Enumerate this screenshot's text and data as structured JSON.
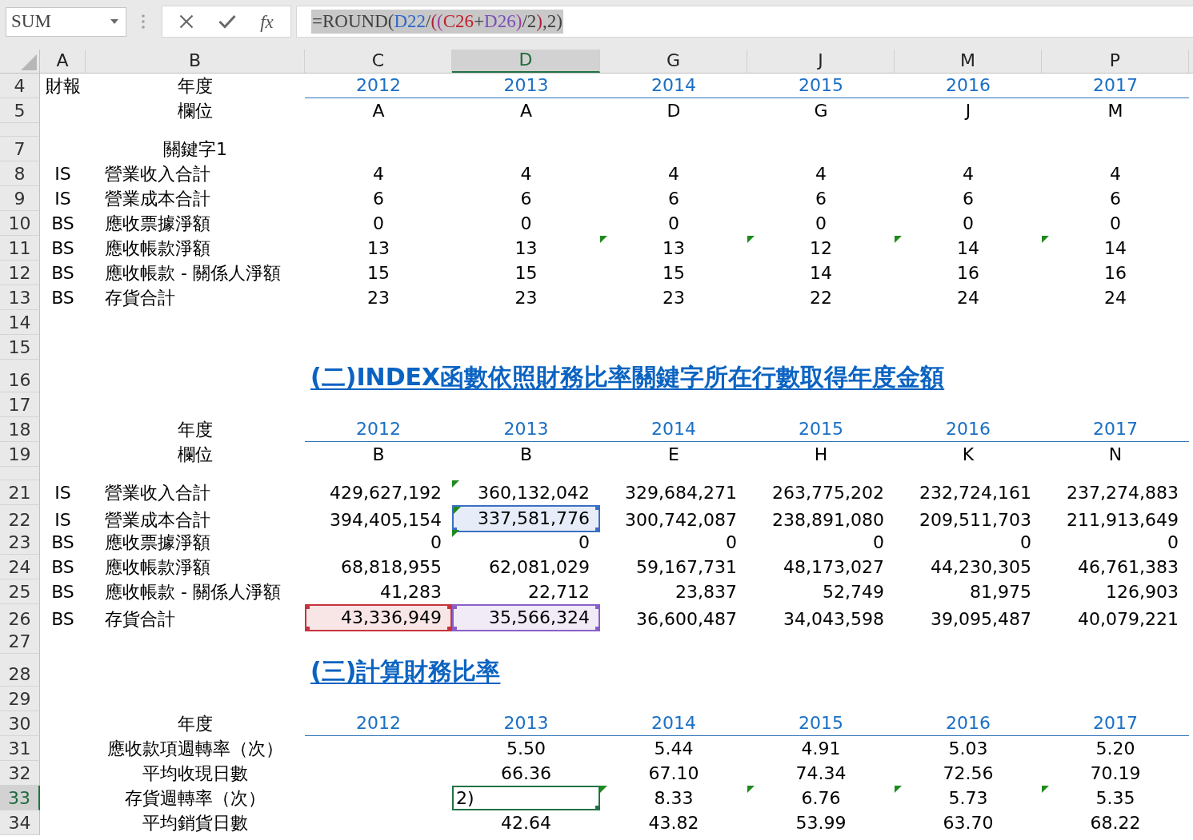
{
  "formula_bar": {
    "name_box": "SUM",
    "function_label": "fx",
    "formula": {
      "selected": true,
      "segments": [
        {
          "text": "=ROUND(",
          "color": "#404040"
        },
        {
          "text": "D22",
          "color": "#2f68c8"
        },
        {
          "text": "/",
          "color": "#404040"
        },
        {
          "text": "(",
          "color": "#b0203c"
        },
        {
          "text": "(",
          "color": "#9a3fa0"
        },
        {
          "text": "C26",
          "color": "#c0202a"
        },
        {
          "text": "+",
          "color": "#404040"
        },
        {
          "text": "D26",
          "color": "#7a4fb8"
        },
        {
          "text": ")",
          "color": "#9a3fa0"
        },
        {
          "text": "/2",
          "color": "#404040"
        },
        {
          "text": ")",
          "color": "#b0203c"
        },
        {
          "text": ",2)",
          "color": "#404040"
        }
      ]
    }
  },
  "sheet": {
    "columns": [
      {
        "label": "A",
        "selected": false
      },
      {
        "label": "B",
        "selected": false
      },
      {
        "label": "C",
        "selected": false
      },
      {
        "label": "D",
        "selected": true
      },
      {
        "label": "G",
        "selected": false
      },
      {
        "label": "J",
        "selected": false
      },
      {
        "label": "M",
        "selected": false
      },
      {
        "label": "P",
        "selected": false
      }
    ],
    "rows": [
      {
        "number": "4",
        "selected": false,
        "kind": "years",
        "a": "財報",
        "b": "年度",
        "cells": [
          "2012",
          "2013",
          "2014",
          "2015",
          "2016",
          "2017"
        ]
      },
      {
        "number": "5",
        "selected": false,
        "kind": "letters",
        "b": "欄位",
        "cells": [
          "A",
          "A",
          "D",
          "G",
          "J",
          "M"
        ]
      },
      {
        "selected": false,
        "kind": "short"
      },
      {
        "number": "7",
        "selected": false,
        "kind": "keyword",
        "b": "關鍵字1"
      },
      {
        "number": "8",
        "selected": false,
        "kind": "lookup",
        "a": "IS",
        "b": "營業收入合計",
        "cells": [
          {
            "text": "4",
            "flag": false,
            "selected": false
          },
          {
            "text": "4",
            "flag": false,
            "selected": false
          },
          {
            "text": "4",
            "flag": false,
            "selected": false
          },
          {
            "text": "4",
            "flag": false,
            "selected": false
          },
          {
            "text": "4",
            "flag": false,
            "selected": false
          },
          {
            "text": "4",
            "flag": false,
            "selected": false
          }
        ]
      },
      {
        "number": "9",
        "selected": false,
        "kind": "lookup",
        "a": "IS",
        "b": "營業成本合計",
        "cells": [
          {
            "text": "6",
            "flag": false,
            "selected": false
          },
          {
            "text": "6",
            "flag": false,
            "selected": false
          },
          {
            "text": "6",
            "flag": false,
            "selected": false
          },
          {
            "text": "6",
            "flag": false,
            "selected": false
          },
          {
            "text": "6",
            "flag": false,
            "selected": false
          },
          {
            "text": "6",
            "flag": false,
            "selected": false
          }
        ]
      },
      {
        "number": "10",
        "selected": false,
        "kind": "lookup",
        "a": "BS",
        "b": "應收票據淨額",
        "cells": [
          {
            "text": "0",
            "flag": false,
            "selected": false
          },
          {
            "text": "0",
            "flag": false,
            "selected": false
          },
          {
            "text": "0",
            "flag": false,
            "selected": false
          },
          {
            "text": "0",
            "flag": false,
            "selected": false
          },
          {
            "text": "0",
            "flag": false,
            "selected": false
          },
          {
            "text": "0",
            "flag": false,
            "selected": false
          }
        ]
      },
      {
        "number": "11",
        "selected": false,
        "kind": "lookup",
        "a": "BS",
        "b": "應收帳款淨額",
        "cells": [
          {
            "text": "13",
            "flag": false,
            "selected": false
          },
          {
            "text": "13",
            "flag": false,
            "selected": false
          },
          {
            "text": "13",
            "flag": true,
            "selected": false
          },
          {
            "text": "12",
            "flag": true,
            "selected": false
          },
          {
            "text": "14",
            "flag": true,
            "selected": false
          },
          {
            "text": "14",
            "flag": true,
            "selected": false
          }
        ]
      },
      {
        "number": "12",
        "selected": false,
        "kind": "lookup",
        "a": "BS",
        "b": "應收帳款 - 關係人淨額",
        "cells": [
          {
            "text": "15",
            "flag": false,
            "selected": false
          },
          {
            "text": "15",
            "flag": false,
            "selected": false
          },
          {
            "text": "15",
            "flag": false,
            "selected": false
          },
          {
            "text": "14",
            "flag": false,
            "selected": false
          },
          {
            "text": "16",
            "flag": false,
            "selected": false
          },
          {
            "text": "16",
            "flag": false,
            "selected": false
          }
        ]
      },
      {
        "number": "13",
        "selected": false,
        "kind": "lookup",
        "a": "BS",
        "b": "存貨合計",
        "cells": [
          {
            "text": "23",
            "flag": false,
            "selected": false
          },
          {
            "text": "23",
            "flag": false,
            "selected": false
          },
          {
            "text": "23",
            "flag": false,
            "selected": false
          },
          {
            "text": "22",
            "flag": false,
            "selected": false
          },
          {
            "text": "24",
            "flag": false,
            "selected": false
          },
          {
            "text": "24",
            "flag": false,
            "selected": false
          }
        ]
      },
      {
        "number": "14",
        "selected": false,
        "kind": "blank"
      },
      {
        "number": "15",
        "selected": false,
        "kind": "blank"
      },
      {
        "number": "16",
        "selected": false,
        "kind": "title",
        "title": "(二)INDEX函數依照財務比率關鍵字所在行數取得年度金額"
      },
      {
        "number": "17",
        "selected": false,
        "kind": "blank"
      },
      {
        "number": "18",
        "selected": false,
        "kind": "years",
        "b": "年度",
        "cells": [
          "2012",
          "2013",
          "2014",
          "2015",
          "2016",
          "2017"
        ]
      },
      {
        "number": "19",
        "selected": false,
        "kind": "letters",
        "b": "欄位",
        "cells": [
          "B",
          "B",
          "E",
          "H",
          "K",
          "N"
        ]
      },
      {
        "selected": false,
        "kind": "short"
      },
      {
        "number": "21",
        "selected": false,
        "kind": "amount",
        "a": "IS",
        "b": "營業收入合計",
        "cells": [
          {
            "text": "429,627,192",
            "flag": false,
            "selected": false
          },
          {
            "text": "360,132,042",
            "flag": true,
            "selected": false
          },
          {
            "text": "329,684,271",
            "flag": false,
            "selected": false
          },
          {
            "text": "263,775,202",
            "flag": false,
            "selected": false
          },
          {
            "text": "232,724,161",
            "flag": false,
            "selected": false
          },
          {
            "text": "237,274,883",
            "flag": false,
            "selected": false
          }
        ]
      },
      {
        "number": "22",
        "selected": false,
        "kind": "amount",
        "a": "IS",
        "b": "營業成本合計",
        "cells": [
          {
            "text": "394,405,154",
            "flag": false,
            "selected": false
          },
          {
            "text": "337,581,776",
            "flag": true,
            "selected": false,
            "color": "#3a6fc4"
          },
          {
            "text": "300,742,087",
            "flag": false,
            "selected": false
          },
          {
            "text": "238,891,080",
            "flag": false,
            "selected": false
          },
          {
            "text": "209,511,703",
            "flag": false,
            "selected": false
          },
          {
            "text": "211,913,649",
            "flag": false,
            "selected": false
          }
        ]
      },
      {
        "number": "23",
        "selected": false,
        "kind": "amount",
        "a": "BS",
        "b": "應收票據淨額",
        "cells": [
          {
            "text": "0",
            "flag": false,
            "selected": false
          },
          {
            "text": "0",
            "flag": true,
            "selected": false
          },
          {
            "text": "0",
            "flag": false,
            "selected": false
          },
          {
            "text": "0",
            "flag": false,
            "selected": false
          },
          {
            "text": "0",
            "flag": false,
            "selected": false
          },
          {
            "text": "0",
            "flag": false,
            "selected": false
          }
        ]
      },
      {
        "number": "24",
        "selected": false,
        "kind": "amount",
        "a": "BS",
        "b": "應收帳款淨額",
        "cells": [
          {
            "text": "68,818,955",
            "flag": false,
            "selected": false
          },
          {
            "text": "62,081,029",
            "flag": false,
            "selected": false
          },
          {
            "text": "59,167,731",
            "flag": false,
            "selected": false
          },
          {
            "text": "48,173,027",
            "flag": false,
            "selected": false
          },
          {
            "text": "44,230,305",
            "flag": false,
            "selected": false
          },
          {
            "text": "46,761,383",
            "flag": false,
            "selected": false
          }
        ]
      },
      {
        "number": "25",
        "selected": false,
        "kind": "amount",
        "a": "BS",
        "b": "應收帳款 - 關係人淨額",
        "cells": [
          {
            "text": "41,283",
            "flag": false,
            "selected": false
          },
          {
            "text": "22,712",
            "flag": false,
            "selected": false
          },
          {
            "text": "23,837",
            "flag": false,
            "selected": false
          },
          {
            "text": "52,749",
            "flag": false,
            "selected": false
          },
          {
            "text": "81,975",
            "flag": false,
            "selected": false
          },
          {
            "text": "126,903",
            "flag": false,
            "selected": false
          }
        ]
      },
      {
        "number": "26",
        "selected": false,
        "kind": "amount",
        "a": "BS",
        "b": "存貨合計",
        "cells": [
          {
            "text": "43,336,949",
            "flag": false,
            "selected": false,
            "color": "#c8323c"
          },
          {
            "text": "35,566,324",
            "flag": false,
            "selected": false,
            "color": "#8a5ec8"
          },
          {
            "text": "36,600,487",
            "flag": false,
            "selected": false
          },
          {
            "text": "34,043,598",
            "flag": false,
            "selected": false
          },
          {
            "text": "39,095,487",
            "flag": false,
            "selected": false
          },
          {
            "text": "40,079,221",
            "flag": false,
            "selected": false
          }
        ]
      },
      {
        "number": "27",
        "selected": false,
        "kind": "blank"
      },
      {
        "number": "28",
        "selected": false,
        "kind": "title",
        "title": "(三)計算財務比率"
      },
      {
        "number": "29",
        "selected": false,
        "kind": "blank"
      },
      {
        "number": "30",
        "selected": false,
        "kind": "years",
        "b": "年度",
        "cells": [
          "2012",
          "2013",
          "2014",
          "2015",
          "2016",
          "2017"
        ]
      },
      {
        "number": "31",
        "selected": false,
        "kind": "ratio",
        "b": "應收款項週轉率（次）",
        "cells": [
          {
            "flag": false,
            "selected": false
          },
          {
            "text": "5.50",
            "flag": false,
            "selected": false
          },
          {
            "text": "5.44",
            "flag": false,
            "selected": false
          },
          {
            "text": "4.91",
            "flag": false,
            "selected": false
          },
          {
            "text": "5.03",
            "flag": false,
            "selected": false
          },
          {
            "text": "5.20",
            "flag": false,
            "selected": false
          }
        ]
      },
      {
        "number": "32",
        "selected": false,
        "kind": "ratio",
        "b": "平均收現日數",
        "cells": [
          {
            "flag": false,
            "selected": false
          },
          {
            "text": "66.36",
            "flag": false,
            "selected": false
          },
          {
            "text": "67.10",
            "flag": false,
            "selected": false
          },
          {
            "text": "74.34",
            "flag": false,
            "selected": false
          },
          {
            "text": "72.56",
            "flag": false,
            "selected": false
          },
          {
            "text": "70.19",
            "flag": false,
            "selected": false
          }
        ]
      },
      {
        "number": "33",
        "selected": true,
        "kind": "ratio",
        "b": "存貨週轉率（次）",
        "cells": [
          {
            "flag": false,
            "selected": false
          },
          {
            "text": "2)",
            "flag": false,
            "selected": true
          },
          {
            "text": "8.33",
            "flag": true,
            "selected": false
          },
          {
            "text": "6.76",
            "flag": true,
            "selected": false
          },
          {
            "text": "5.73",
            "flag": true,
            "selected": false
          },
          {
            "text": "5.35",
            "flag": true,
            "selected": false
          }
        ]
      },
      {
        "number": "34",
        "selected": false,
        "kind": "ratio",
        "b": "平均銷貨日數",
        "cells": [
          {
            "flag": false,
            "selected": false
          },
          {
            "text": "42.64",
            "flag": false,
            "selected": false
          },
          {
            "text": "43.82",
            "flag": false,
            "selected": false
          },
          {
            "text": "53.99",
            "flag": false,
            "selected": false
          },
          {
            "text": "63.70",
            "flag": false,
            "selected": false
          },
          {
            "text": "68.22",
            "flag": false,
            "selected": false
          }
        ]
      }
    ]
  }
}
